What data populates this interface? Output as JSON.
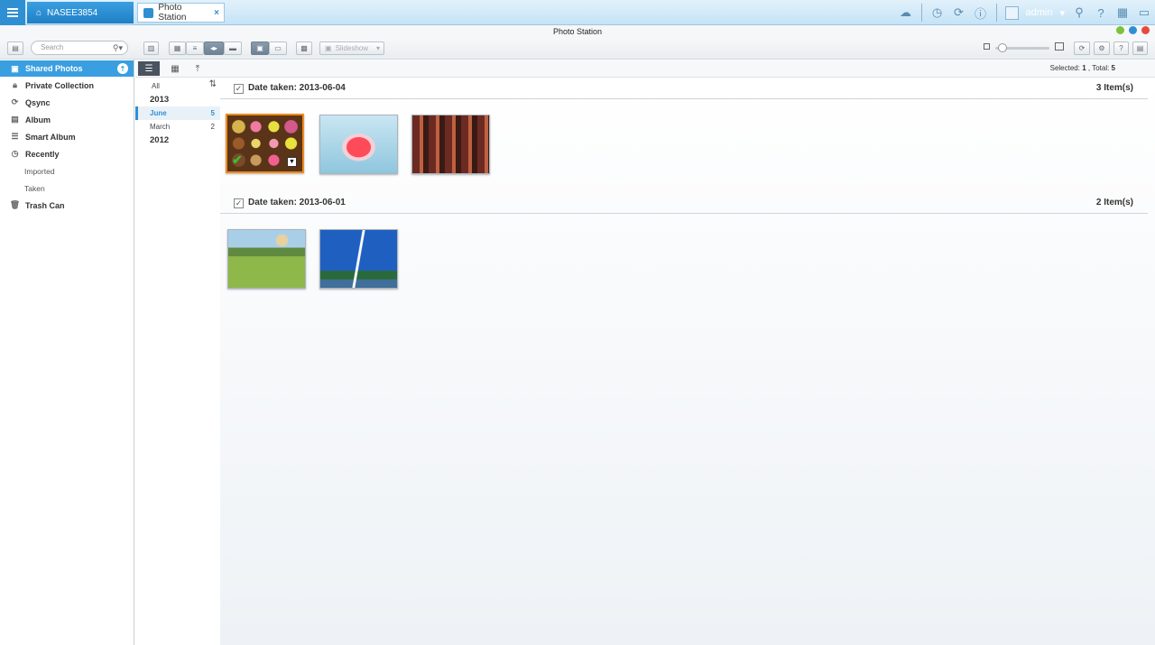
{
  "os": {
    "nas_name": "NASEE3854",
    "app_tab_label": "Photo Station",
    "tab_close": "×",
    "user": "admin"
  },
  "window": {
    "title": "Photo Station"
  },
  "toolbar": {
    "search_placeholder": "Search",
    "slideshow_label": "Slideshow"
  },
  "sidebar": {
    "items": [
      {
        "label": "Shared Photos",
        "icon": "photo-icon"
      },
      {
        "label": "Private Collection",
        "icon": "lock-icon"
      },
      {
        "label": "Qsync",
        "icon": "sync-icon"
      },
      {
        "label": "Album",
        "icon": "album-icon"
      },
      {
        "label": "Smart Album",
        "icon": "smart-album-icon"
      },
      {
        "label": "Recently",
        "icon": "clock-icon"
      },
      {
        "label": "Imported"
      },
      {
        "label": "Taken"
      },
      {
        "label": "Trash Can",
        "icon": "trash-icon"
      }
    ]
  },
  "status": {
    "selected_label": "Selected:",
    "selected": "1",
    "total_label": ", Total:",
    "total": "5"
  },
  "timeline": {
    "all": "All",
    "rows": [
      {
        "label": "2013"
      },
      {
        "label": "June",
        "count": "5"
      },
      {
        "label": "March",
        "count": "2"
      },
      {
        "label": "2012"
      }
    ]
  },
  "groups": [
    {
      "title": "Date taken: 2013-06-04",
      "count": "3 Item(s)"
    },
    {
      "title": "Date taken: 2013-06-01",
      "count": "2 Item(s)"
    }
  ],
  "colors": {
    "accent": "#3a9fe0",
    "selection": "#f08a1b"
  }
}
